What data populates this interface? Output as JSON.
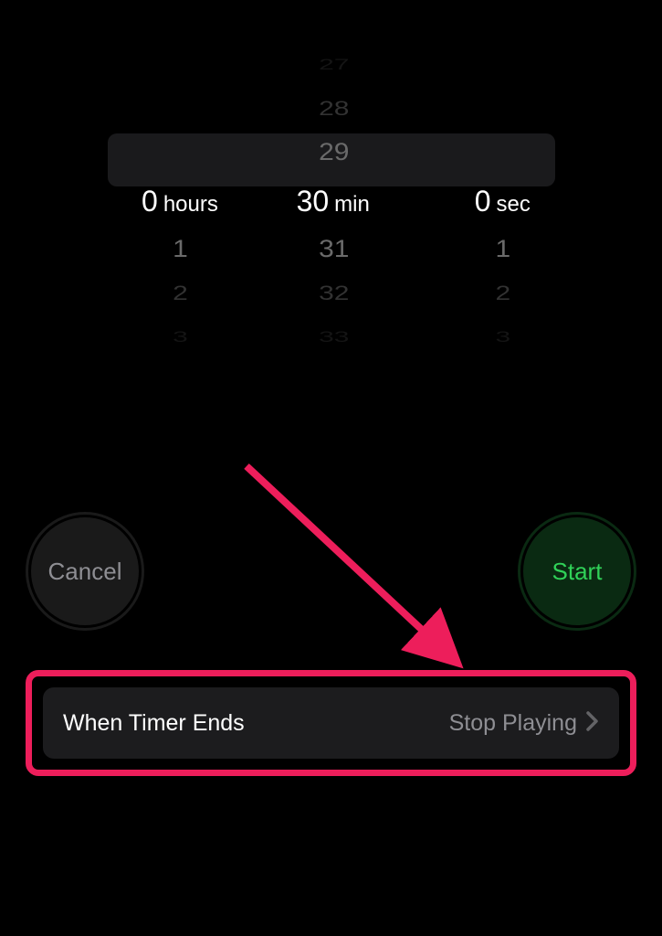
{
  "picker": {
    "hours": {
      "items_above": [],
      "selected": "0",
      "unit": "hours",
      "items_below": [
        "1",
        "2",
        "3"
      ]
    },
    "minutes": {
      "items_above": [
        "27",
        "28",
        "29"
      ],
      "selected": "30",
      "unit": "min",
      "items_below": [
        "31",
        "32",
        "33"
      ]
    },
    "seconds": {
      "items_above": [],
      "selected": "0",
      "unit": "sec",
      "items_below": [
        "1",
        "2",
        "3"
      ]
    }
  },
  "buttons": {
    "cancel": "Cancel",
    "start": "Start"
  },
  "timer_ends": {
    "label": "When Timer Ends",
    "value": "Stop Playing"
  },
  "annotation": {
    "color": "#ed1e5b"
  }
}
